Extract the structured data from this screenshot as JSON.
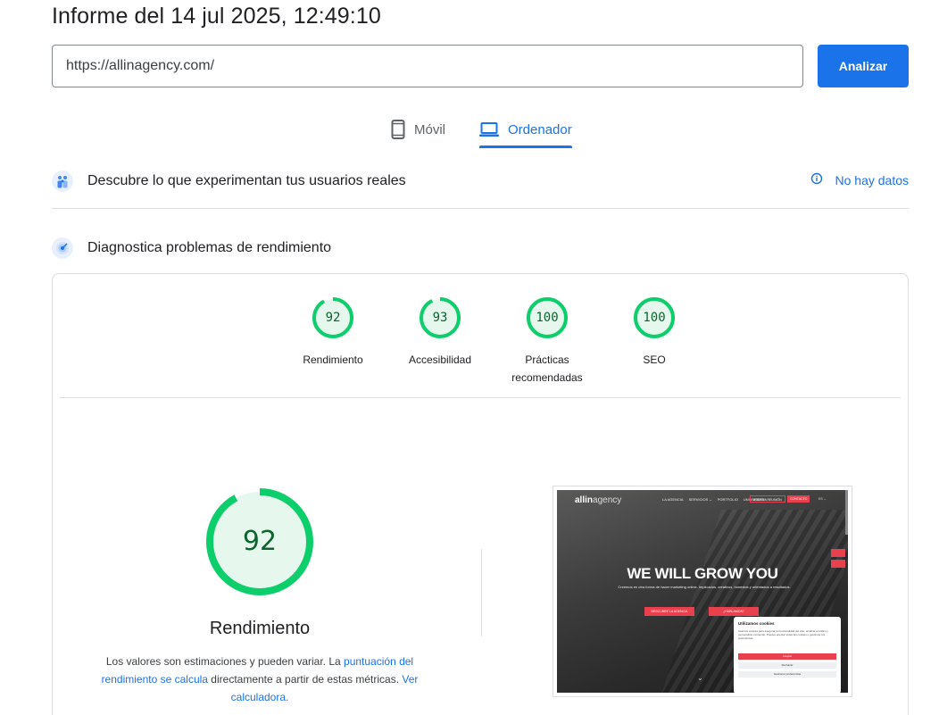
{
  "header": {
    "title": "Informe del 14 jul 2025, 12:49:10"
  },
  "search": {
    "url_value": "https://allinagency.com/",
    "analyze_label": "Analizar"
  },
  "tabs": [
    {
      "label": "Móvil",
      "icon": "smartphone-icon",
      "active": false
    },
    {
      "label": "Ordenador",
      "icon": "laptop-icon",
      "active": true
    }
  ],
  "field_data": {
    "title": "Descubre lo que experimentan tus usuarios reales",
    "status": "No hay datos"
  },
  "lab_data": {
    "title": "Diagnostica problemas de rendimiento"
  },
  "scores": [
    {
      "value": "92",
      "label": "Rendimiento",
      "fraction": 0.92
    },
    {
      "value": "93",
      "label": "Accesibilidad",
      "fraction": 0.93
    },
    {
      "value": "100",
      "label": "Prácticas recomendadas",
      "fraction": 1.0
    },
    {
      "value": "100",
      "label": "SEO",
      "fraction": 1.0
    }
  ],
  "performance": {
    "score": "92",
    "fraction": 0.92,
    "label": "Rendimiento",
    "desc_1": "Los valores son estimaciones y pueden variar. La ",
    "desc_link_1": "puntuación del rendimiento se calcula",
    "desc_2": " directamente a partir de estas métricas. ",
    "desc_link_2": "Ver calculadora."
  },
  "screenshot": {
    "logo_bold": "allin",
    "logo_rest": "agency",
    "nav_items": [
      "LA AGENCIA",
      "SERVICIOS ⌄",
      "PORTFOLIO",
      "UNIVERSITY"
    ],
    "nav_btn_1": "AGENDA REUNIÓN",
    "nav_btn_2": "CONTACTO",
    "lang": "ES ⌄",
    "hero_title": "WE WILL GROW YOU",
    "hero_sub": "Creemos en otra forma de hacer marketing online. Implicados, creativos, honestos y orientados a resultados.",
    "hero_btn_1": "DESCUBRE LA AGENCIA",
    "hero_btn_2": "¿HABLAMOS?",
    "cookie_title": "Utilizamos cookies",
    "cookie_text": "Usamos cookies para asegurar la funcionalidad del sitio, analizar el tráfico y personalizar contenido. Puedes aceptar todas las cookies o gestionar tus preferencias.",
    "cookie_accept": "Aceptar",
    "cookie_reject": "Rechazar",
    "cookie_prefs": "Gestionar preferencias"
  },
  "colors": {
    "accent": "#1a73e8",
    "pass": "#0cce6b",
    "pass_text": "#0d652d",
    "pass_bg": "#e6f8ee",
    "brand_red": "#e8414d"
  }
}
